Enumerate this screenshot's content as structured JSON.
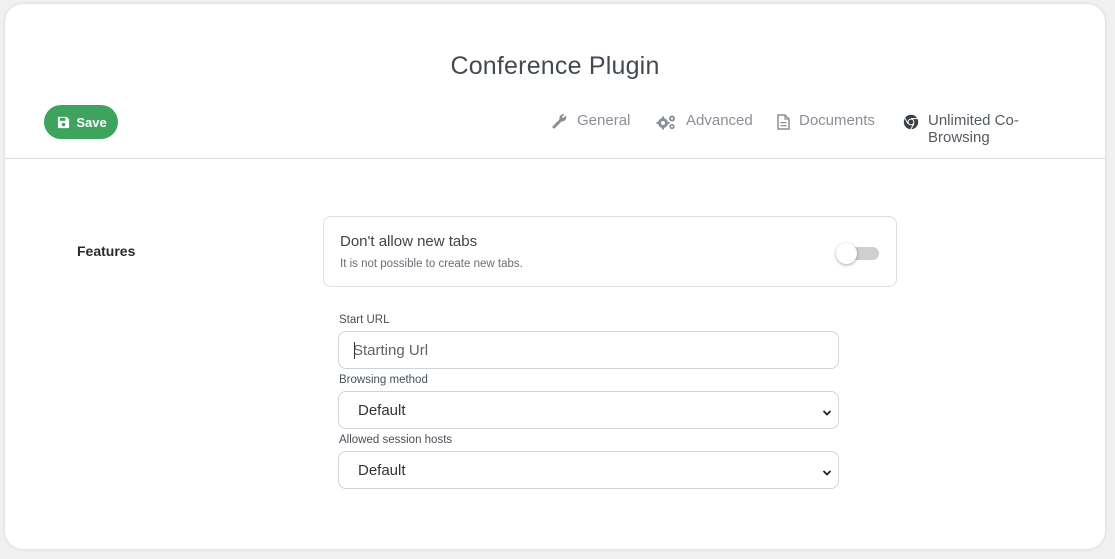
{
  "page": {
    "title": "Conference Plugin"
  },
  "toolbar": {
    "save_label": "Save",
    "save_icon": "floppy-disk-icon",
    "save_color": "#3da35d"
  },
  "tabs": [
    {
      "label": "General",
      "icon": "wrench-icon",
      "active": false
    },
    {
      "label": "Advanced",
      "icon": "gears-icon",
      "active": false
    },
    {
      "label": "Documents",
      "icon": "document-icon",
      "active": false
    },
    {
      "label": "Unlimited Co-Browsing",
      "icon": "chrome-icon",
      "active": true
    }
  ],
  "section": {
    "label": "Features"
  },
  "option": {
    "title": "Don't allow new tabs",
    "description": "It is not possible to create new tabs.",
    "enabled": false
  },
  "form": {
    "start_url": {
      "label": "Start URL",
      "placeholder": "Starting Url",
      "value": ""
    },
    "browsing_method": {
      "label": "Browsing method",
      "selected": "Default"
    },
    "session_hosts": {
      "label": "Allowed session hosts",
      "selected": "Default"
    }
  }
}
